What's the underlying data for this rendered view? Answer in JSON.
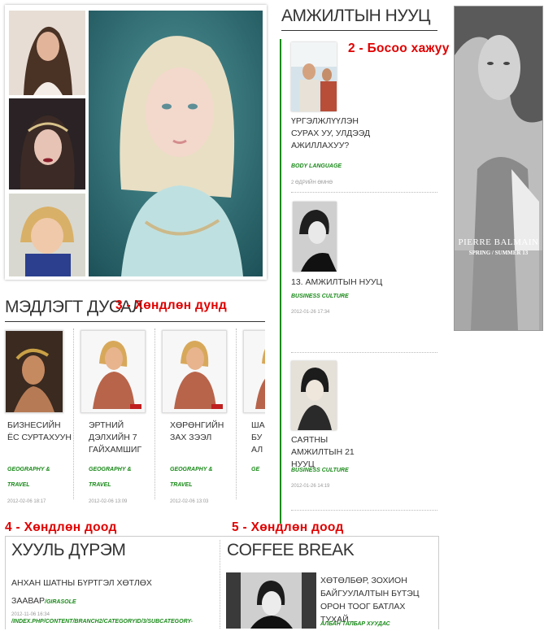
{
  "colors": {
    "accent_green": "#1a8a1a",
    "annotation_red": "#e00000",
    "divider": "#333333"
  },
  "hero": {
    "thumbs": [
      "woman-dark-hair-photo",
      "woman-headpiece-photo",
      "child-tshirt-photo"
    ],
    "main": "blonde-woman-portrait-photo"
  },
  "success": {
    "title": "АМЖИЛТЫН НУУЦ",
    "items": [
      {
        "title": "ҮРГЭЛЖЛҮҮЛЭН СУРАХ УУ, УЛДЭЭД АЖИЛЛАХУУ?",
        "category": "BODY LANGUAGE",
        "date": "2 ӨДРИЙН ӨМНӨ"
      },
      {
        "title": "13. АМЖИЛТЫН НУУЦ",
        "category": "BUSINESS CULTURE",
        "date": "2012-01-26 17:34"
      },
      {
        "title": "САЯТНЫ АМЖИЛТЫН 21 НУУЦ",
        "category": "BUSINESS CULTURE",
        "date": "2012-01-26 14:19"
      }
    ]
  },
  "knowledge": {
    "title": "МЭДЛЭГТ ДУСАЛ",
    "cards": [
      {
        "title": "БИЗНЕСИЙН ЁС СУРТАХУУН",
        "category": "GEOGRAPHY & TRAVEL",
        "date": "2012-02-06 18:17"
      },
      {
        "title": "ЭРТНИЙ ДЭЛХИЙН 7 ГАЙХАМШИГ",
        "category": "GEOGRAPHY & TRAVEL",
        "date": "2012-02-06 13:09"
      },
      {
        "title": "ХӨРӨНГИЙН ЗАХ ЗЭЭЛ",
        "category": "GEOGRAPHY & TRAVEL",
        "date": "2012-02-06 13:03"
      },
      {
        "title": "ША БУ АЛ",
        "category": "GE",
        "date": ""
      }
    ]
  },
  "law": {
    "title": "ХУУЛЬ ДҮРЭМ",
    "headline": "АНХАН ШАТНЫ БҮРТГЭЛ ХӨТЛӨХ ЗААВАР",
    "link": "/GIRASOLE /INDEX.PHP/CONTENT/BRANCH2/CATEGORYID/3/SUBCATEGORY-",
    "date": "2012-11-06 16:34"
  },
  "coffee": {
    "title": "COFFEE BREAK",
    "headline": "ХӨТӨЛБӨР, ЗОХИОН БАЙГУУЛАЛТЫН БҮТЭЦ ОРОН ТООГ БАТЛАХ ТУХАЙ...",
    "category": "АЛБАН ТАЛБАР ХУУДАС"
  },
  "ad": {
    "brand": "PIERRE BALMAIN",
    "season": "SPRING / SUMMER 13"
  },
  "annotations": {
    "a2": "2 - Босоо хажуу",
    "a3": "3 - Хөндлөн дунд",
    "a4": "4 - Хөндлөн доод",
    "a5": "5 - Хөндлөн доод"
  }
}
